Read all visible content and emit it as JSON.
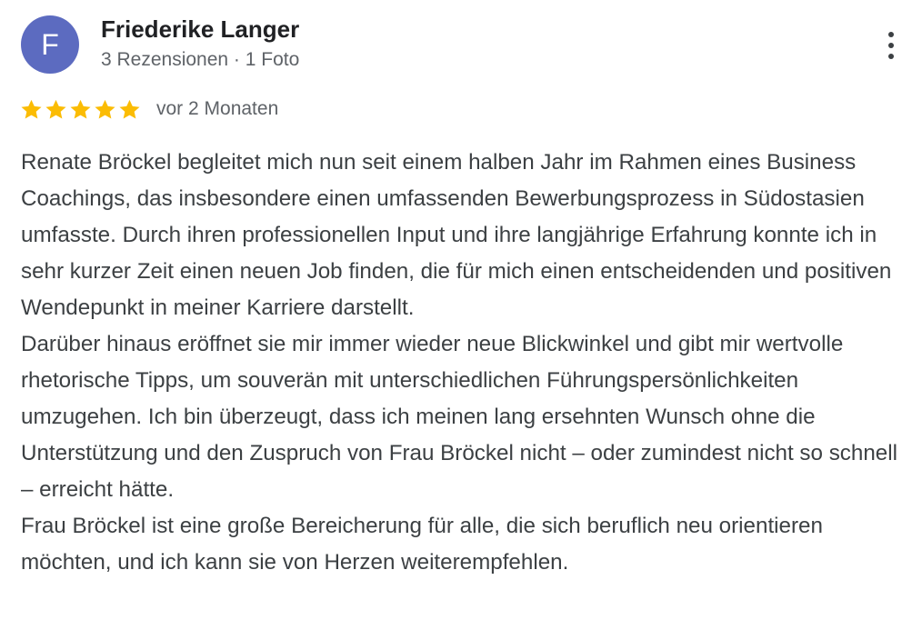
{
  "reviewer": {
    "avatar_initial": "F",
    "avatar_color": "#5c6bc0",
    "name": "Friederike Langer",
    "meta": "3 Rezensionen · 1 Foto"
  },
  "menu": {
    "icon": "more-vert-icon"
  },
  "rating": {
    "stars": 5,
    "max": 5,
    "star_color": "#fbbc04",
    "date": "vor 2 Monaten"
  },
  "review": {
    "paragraphs": [
      "Renate Bröckel begleitet mich nun seit einem halben Jahr im Rahmen eines Business Coachings, das insbesondere einen umfassenden Bewerbungsprozess in Südostasien umfasste. Durch ihren professionellen Input und ihre langjährige Erfahrung konnte ich in sehr kurzer Zeit einen neuen Job finden, die für mich einen entscheidenden und positiven Wendepunkt in meiner Karriere darstellt.",
      "Darüber hinaus eröffnet sie mir immer wieder neue Blickwinkel und gibt mir wertvolle rhetorische Tipps, um souverän mit unterschiedlichen Führungspersönlichkeiten umzugehen. Ich bin überzeugt, dass ich meinen lang ersehnten Wunsch ohne die Unterstützung und den Zuspruch von Frau Bröckel nicht – oder zumindest nicht so schnell – erreicht hätte.",
      "Frau Bröckel ist eine große Bereicherung für alle, die sich beruflich neu orientieren möchten, und ich kann sie von Herzen weiterempfehlen."
    ]
  }
}
